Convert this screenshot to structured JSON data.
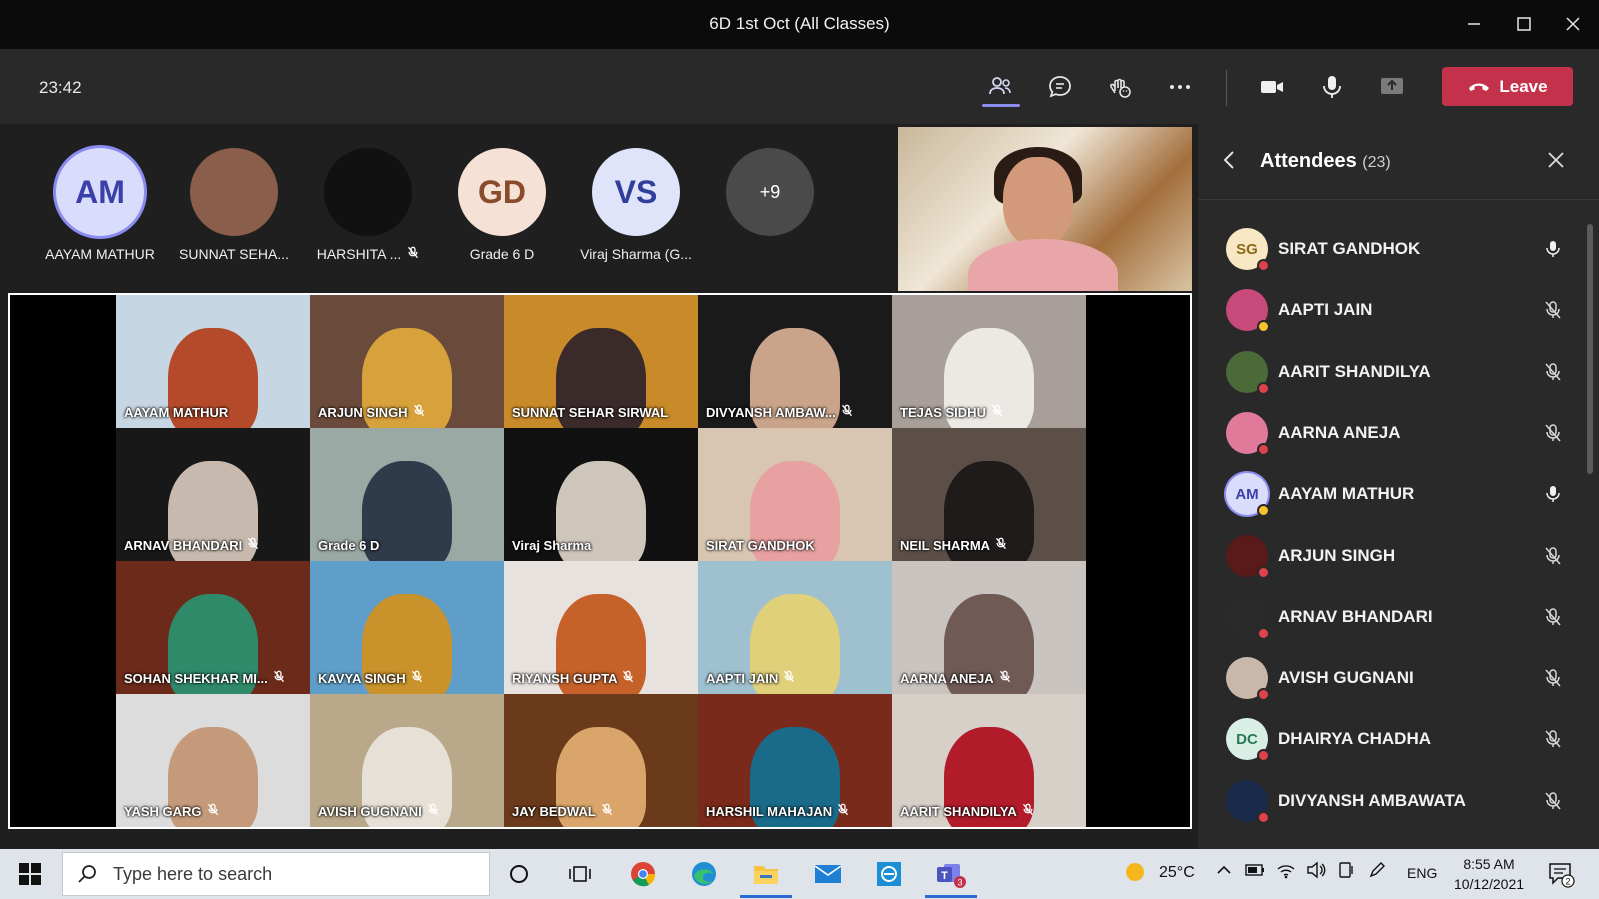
{
  "window": {
    "title": "6D 1st Oct (All Classes)"
  },
  "toolbar": {
    "timer": "23:42",
    "leave_label": "Leave"
  },
  "avatars": [
    {
      "initials": "AM",
      "name": "AAYAM MATHUR",
      "bg": "#d9dcfb",
      "color": "#3b3fa8",
      "muted": false
    },
    {
      "initials": "",
      "name": "SUNNAT SEHA...",
      "bg": "#8a5e4b",
      "color": "#ffffff",
      "muted": false
    },
    {
      "initials": "",
      "name": "HARSHITA ...",
      "bg": "#111111",
      "color": "#7b6dff",
      "muted": true
    },
    {
      "initials": "GD",
      "name": "Grade 6 D",
      "bg": "#f6e1d6",
      "color": "#8a4b2c",
      "muted": false
    },
    {
      "initials": "VS",
      "name": "Viraj Sharma (G...",
      "bg": "#dfe4fb",
      "color": "#2f3f9a",
      "muted": false
    },
    {
      "initials": "+9",
      "name": "",
      "bg": "#4a4a4a",
      "color": "#ffffff",
      "muted": false
    }
  ],
  "tiles": [
    {
      "name": "AAYAM MATHUR",
      "bg": "#c7d6e3",
      "fig": "#b54a2a",
      "muted": false
    },
    {
      "name": "ARJUN SINGH",
      "bg": "#6a4a3a",
      "fig": "#d7a13b",
      "muted": true
    },
    {
      "name": "SUNNAT SEHAR SIRWAL",
      "bg": "#c98a2a",
      "fig": "#3a2a2a",
      "muted": false
    },
    {
      "name": "DIVYANSH AMBAW...",
      "bg": "#1a1a1a",
      "fig": "#c9a48a",
      "muted": true
    },
    {
      "name": "TEJAS SIDHU",
      "bg": "#a89f9a",
      "fig": "#ece9e4",
      "muted": true
    },
    {
      "name": "ARNAV BHANDARI",
      "bg": "#181818",
      "fig": "#c7b9ad",
      "muted": true
    },
    {
      "name": "Grade 6 D",
      "bg": "#9aa9a4",
      "fig": "#2f3a4a",
      "muted": false
    },
    {
      "name": "Viraj Sharma",
      "bg": "#111111",
      "fig": "#cfc6bb",
      "muted": false
    },
    {
      "name": "SIRAT GANDHOK",
      "bg": "#d8c6b3",
      "fig": "#e6a1a0",
      "muted": false
    },
    {
      "name": "NEIL SHARMA",
      "bg": "#5c4f47",
      "fig": "#1f1b1b",
      "muted": true
    },
    {
      "name": "SOHAN SHEKHAR MI...",
      "bg": "#6b2a1a",
      "fig": "#2f8a6a",
      "muted": true
    },
    {
      "name": "KAVYA SINGH",
      "bg": "#5f9ec9",
      "fig": "#c9922a",
      "muted": true
    },
    {
      "name": "RIYANSH GUPTA",
      "bg": "#e8e2de",
      "fig": "#c7612a",
      "muted": true
    },
    {
      "name": "AAPTI JAIN",
      "bg": "#9ec0cf",
      "fig": "#e0d07a",
      "muted": true
    },
    {
      "name": "AARNA ANEJA",
      "bg": "#c9c4bf",
      "fig": "#6f5a55",
      "muted": true
    },
    {
      "name": "YASH GARG",
      "bg": "#dcdcdc",
      "fig": "#c49a7a",
      "muted": true
    },
    {
      "name": "AVISH GUGNANI",
      "bg": "#b9a889",
      "fig": "#e6e0d6",
      "muted": true
    },
    {
      "name": "JAY BEDWAL",
      "bg": "#6b3a1a",
      "fig": "#d9a56a",
      "muted": true
    },
    {
      "name": "HARSHIL MAHAJAN",
      "bg": "#7a2a1a",
      "fig": "#1a6a8a",
      "muted": true
    },
    {
      "name": "AARIT SHANDILYA",
      "bg": "#d6d0c9",
      "fig": "#b11b2a",
      "muted": true
    }
  ],
  "attendees": {
    "title": "Attendees",
    "count": "(23)",
    "list": [
      {
        "name": "SIRAT GANDHOK",
        "initials": "SG",
        "bg": "#f7e7c2",
        "color": "#8a6a1a",
        "status": "busy",
        "mic": "on"
      },
      {
        "name": "AAPTI JAIN",
        "initials": "",
        "bg": "#c84a7a",
        "color": "#fff",
        "status": "away",
        "mic": "off"
      },
      {
        "name": "AARIT SHANDILYA",
        "initials": "",
        "bg": "#4a6a3a",
        "color": "#fff",
        "status": "busy",
        "mic": "off"
      },
      {
        "name": "AARNA ANEJA",
        "initials": "",
        "bg": "#e07a9a",
        "color": "#fff",
        "status": "busy",
        "mic": "off"
      },
      {
        "name": "AAYAM MATHUR",
        "initials": "AM",
        "bg": "#d9dcfb",
        "color": "#3b3fa8",
        "status": "away",
        "mic": "on"
      },
      {
        "name": "ARJUN SINGH",
        "initials": "",
        "bg": "#5a1a1a",
        "color": "#fff",
        "status": "busy",
        "mic": "off"
      },
      {
        "name": "ARNAV BHANDARI",
        "initials": "",
        "bg": "#2a2a2a",
        "color": "#f0c02a",
        "status": "busy",
        "mic": "off"
      },
      {
        "name": "AVISH GUGNANI",
        "initials": "",
        "bg": "#c9b8aa",
        "color": "#fff",
        "status": "busy",
        "mic": "off"
      },
      {
        "name": "DHAIRYA CHADHA",
        "initials": "DC",
        "bg": "#d9efe6",
        "color": "#2a7a5a",
        "status": "busy",
        "mic": "off"
      },
      {
        "name": "DIVYANSH AMBAWATA",
        "initials": "",
        "bg": "#1a2a4a",
        "color": "#fff",
        "status": "busy",
        "mic": "off"
      }
    ]
  },
  "taskbar": {
    "search_placeholder": "Type here to search",
    "weather": "25°C",
    "lang": "ENG",
    "time": "8:55 AM",
    "date": "10/12/2021",
    "teams_badge": "3",
    "notif_badge": "2"
  }
}
